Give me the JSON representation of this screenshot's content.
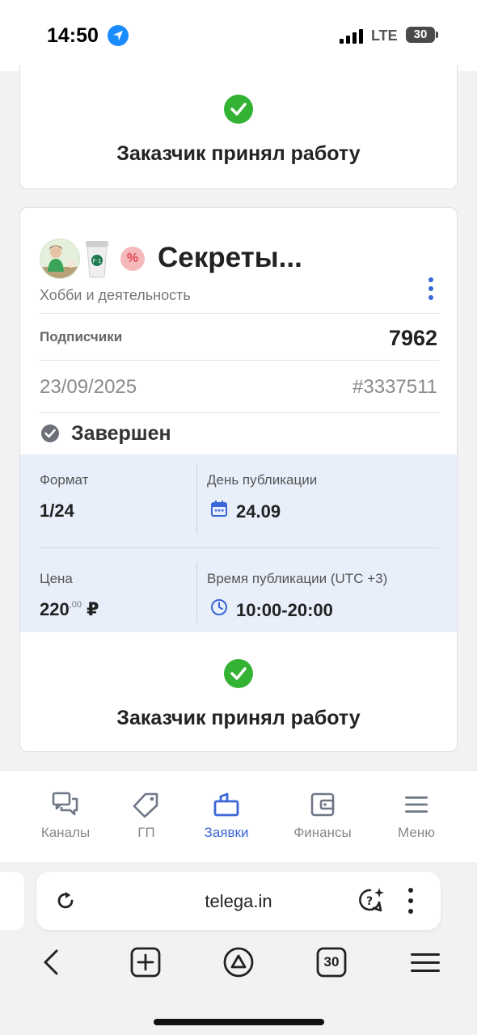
{
  "status_bar": {
    "time": "14:50",
    "network": "LTE",
    "battery": "30"
  },
  "top_card": {
    "accepted_text": "Заказчик принял работу"
  },
  "order": {
    "channel_title": "Секреты...",
    "badge": "%",
    "category": "Хобби и деятельность",
    "subscribers_label": "Подписчики",
    "subscribers_value": "7962",
    "date": "23/09/2025",
    "order_id": "#3337511",
    "status": "Завершен",
    "format_label": "Формат",
    "format_value": "1/24",
    "publish_day_label": "День публикации",
    "publish_day_value": "24.09",
    "price_label": "Цена",
    "price_value": "220",
    "price_cents": ",00",
    "price_currency": "₽",
    "publish_time_label": "Время публикации (UTC +3)",
    "publish_time_value": "10:00-20:00",
    "accepted_text": "Заказчик принял работу"
  },
  "bottom_nav": {
    "items": [
      {
        "label": "Каналы",
        "icon": "chat-icon"
      },
      {
        "label": "ГП",
        "icon": "tag-icon"
      },
      {
        "label": "Заявки",
        "icon": "requests-icon",
        "active": true
      },
      {
        "label": "Финансы",
        "icon": "wallet-icon"
      },
      {
        "label": "Меню",
        "icon": "menu-icon"
      }
    ]
  },
  "browser": {
    "url": "telega.in",
    "tabs_count": "30"
  },
  "colors": {
    "accent": "#3a66d6",
    "success": "#34b233",
    "info_bg": "#e8effb",
    "badge_bg": "#f6b9bb"
  }
}
